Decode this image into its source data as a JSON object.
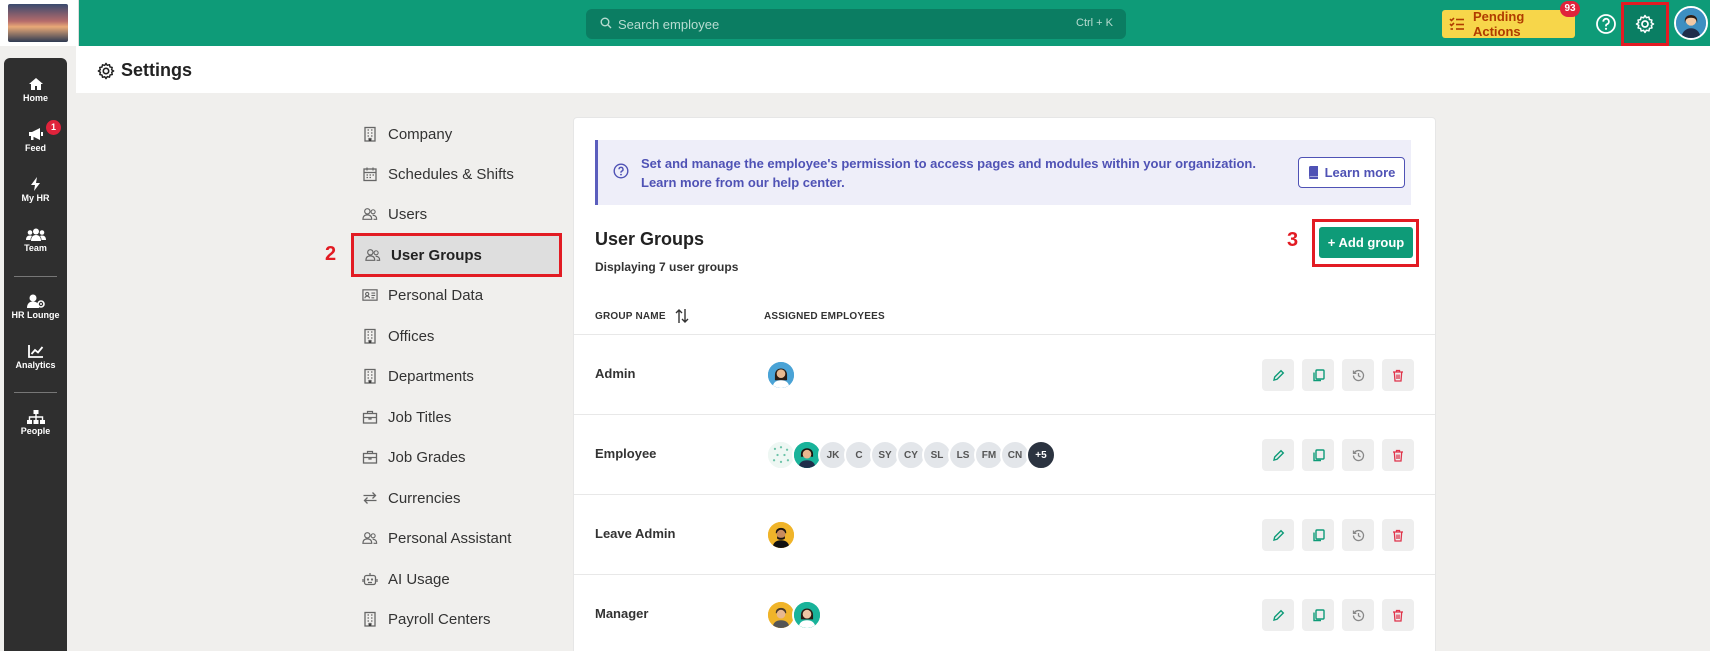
{
  "topbar": {
    "search_placeholder": "Search employee",
    "search_hint": "Ctrl + K",
    "pending_label": "Pending Actions",
    "pending_count": "93"
  },
  "sidebar": {
    "items": [
      {
        "label": "Home",
        "icon": "home-icon"
      },
      {
        "label": "Feed",
        "icon": "megaphone-icon",
        "badge": "1"
      },
      {
        "label": "My HR",
        "icon": "bolt-icon"
      },
      {
        "label": "Team",
        "icon": "team-icon"
      },
      {
        "label": "HR Lounge",
        "icon": "user-gear-icon"
      },
      {
        "label": "Analytics",
        "icon": "chart-icon"
      },
      {
        "label": "People",
        "icon": "org-chart-icon"
      }
    ]
  },
  "page": {
    "title": "Settings"
  },
  "menu": {
    "items": [
      {
        "label": "Company",
        "icon": "building-icon"
      },
      {
        "label": "Schedules & Shifts",
        "icon": "calendar-icon"
      },
      {
        "label": "Users",
        "icon": "users-icon"
      },
      {
        "label": "User Groups",
        "icon": "users-icon",
        "active": true
      },
      {
        "label": "Personal Data",
        "icon": "id-card-icon"
      },
      {
        "label": "Offices",
        "icon": "building-icon"
      },
      {
        "label": "Departments",
        "icon": "building-icon"
      },
      {
        "label": "Job Titles",
        "icon": "briefcase-icon"
      },
      {
        "label": "Job Grades",
        "icon": "briefcase-icon"
      },
      {
        "label": "Currencies",
        "icon": "exchange-icon"
      },
      {
        "label": "Personal Assistant",
        "icon": "users-icon"
      },
      {
        "label": "AI Usage",
        "icon": "robot-icon"
      },
      {
        "label": "Payroll Centers",
        "icon": "building-icon"
      }
    ]
  },
  "annotations": {
    "one": "1",
    "two": "2",
    "three": "3"
  },
  "info": {
    "text": "Set and manage the employee's permission to access pages and modules within your organization. Learn more from our help center.",
    "learn_more": "Learn more"
  },
  "groups": {
    "title": "User Groups",
    "count_text": "Displaying 7 user groups",
    "add_label": "+ Add group",
    "col_name": "GROUP NAME",
    "col_assigned": "ASSIGNED EMPLOYEES",
    "rows": [
      {
        "name": "Admin",
        "avatars": [
          "photo"
        ]
      },
      {
        "name": "Employee",
        "avatars": [
          "pattern",
          "photo",
          "JK",
          "C",
          "SY",
          "CY",
          "SL",
          "LS",
          "FM",
          "CN",
          "+5"
        ]
      },
      {
        "name": "Leave Admin",
        "avatars": [
          "photo"
        ]
      },
      {
        "name": "Manager",
        "avatars": [
          "photo",
          "photo"
        ]
      }
    ]
  },
  "colors": {
    "brand": "#0e9b78",
    "highlight": "#e21b23",
    "info": "#4f52b5",
    "pending": "#f7d64a"
  }
}
